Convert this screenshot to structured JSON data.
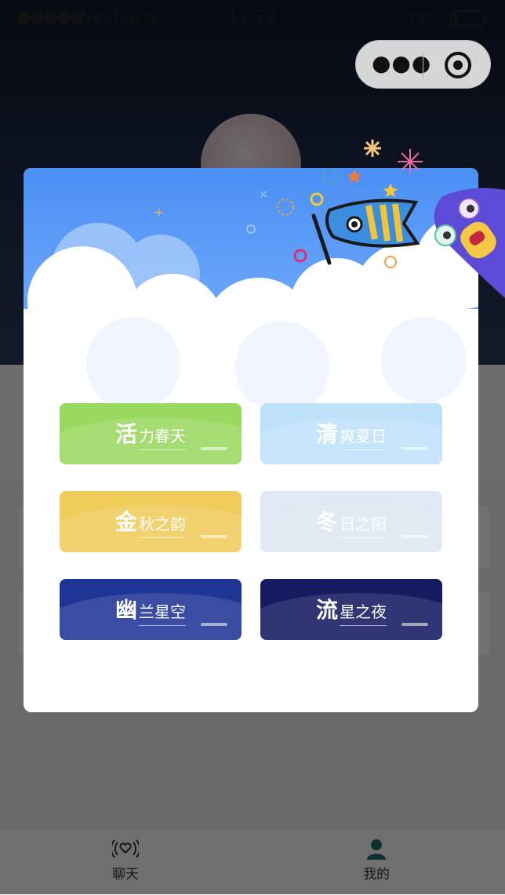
{
  "status_bar": {
    "signal": "●●●●●",
    "carrier": "WeChat",
    "time": "12:22",
    "battery_percent": "14%",
    "battery_level": 0.14
  },
  "capsule": {
    "more_icon": "more-dots-icon",
    "close_icon": "target-close-icon"
  },
  "themes": [
    {
      "first": "活",
      "rest": "力春天",
      "color": "#9ad95f"
    },
    {
      "first": "清",
      "rest": "爽夏日",
      "color": "#bfe2fb"
    },
    {
      "first": "金",
      "rest": "秋之韵",
      "color": "#f0cc5a"
    },
    {
      "first": "冬",
      "rest": "日之阳",
      "color": "#dfe8f3"
    },
    {
      "first": "幽",
      "rest": "兰星空",
      "color": "#1f3596"
    },
    {
      "first": "流",
      "rest": "星之夜",
      "color": "#161a60"
    }
  ],
  "tabbar": {
    "chat": {
      "label": "聊天",
      "icon": "radio-heart-icon"
    },
    "mine": {
      "label": "我的",
      "icon": "person-icon"
    }
  }
}
